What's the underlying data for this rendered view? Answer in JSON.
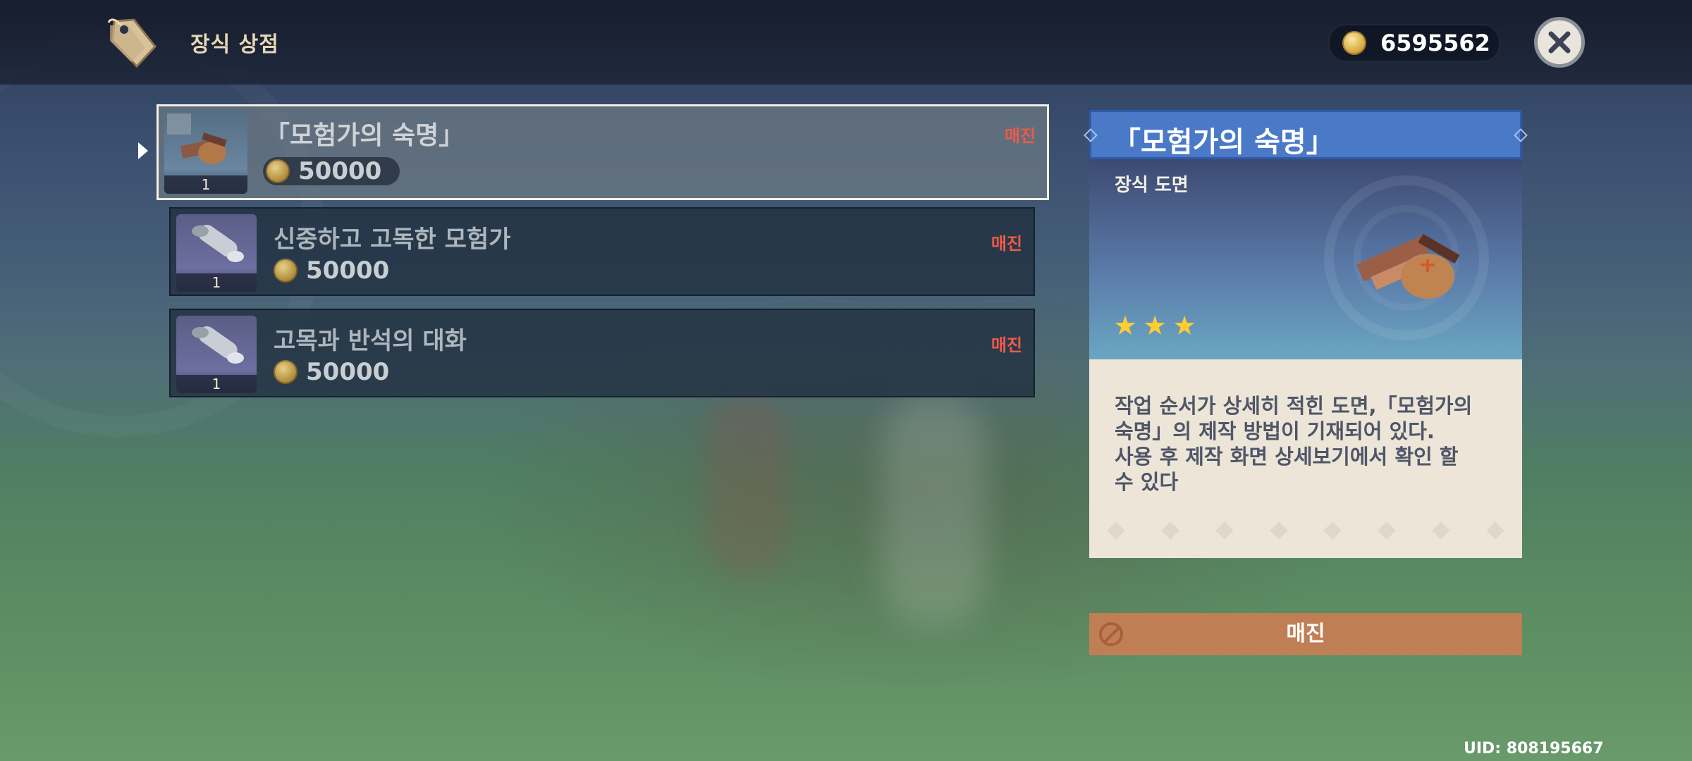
{
  "header": {
    "title": "장식 상점",
    "currency_amount": "6595562"
  },
  "items": [
    {
      "name": "「모험가의 숙명」",
      "price": "50000",
      "status": "매진",
      "qty": "1",
      "selected": true,
      "icon": "adventurer-bag-icon"
    },
    {
      "name": "신중하고 고독한 모험가",
      "price": "50000",
      "status": "매진",
      "qty": "1",
      "selected": false,
      "icon": "blueprint-scroll-icon"
    },
    {
      "name": "고목과 반석의 대화",
      "price": "50000",
      "status": "매진",
      "qty": "1",
      "selected": false,
      "icon": "blueprint-scroll-icon"
    }
  ],
  "detail": {
    "title": "「모험가의 숙명」",
    "type": "장식 도면",
    "rarity": 3,
    "description": "작업 순서가 상세히 적힌 도면,「모험가의\n숙명」의 제작 방법이 기재되어 있다.\n사용 후 제작 화면 상세보기에서 확인 할\n수 있다",
    "button_label": "매진"
  },
  "uid": "UID: 808195667",
  "colors": {
    "sold_out": "#ef5a48",
    "detail_header": "#4a79c8",
    "button": "#c07e55",
    "star": "#ffcc32"
  }
}
